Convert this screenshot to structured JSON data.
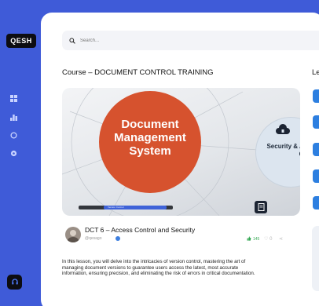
{
  "app": {
    "logo": "QESH"
  },
  "sidebar": {
    "items": [
      {
        "icon": "grid-icon"
      },
      {
        "icon": "chart-icon"
      },
      {
        "icon": "chat-icon"
      },
      {
        "icon": "settings-icon"
      }
    ],
    "help_icon": "headset-icon"
  },
  "search": {
    "placeholder": "Search..."
  },
  "course": {
    "title": "Course – DOCUMENT CONTROL TRAINING"
  },
  "side_panel": {
    "heading": "Le"
  },
  "video": {
    "main_circle_text": "Document Management System",
    "secondary_circle_text": "Security & Access Control",
    "bar_text": "Version Control"
  },
  "lesson": {
    "title": "DCT 6 – Access Control and Security",
    "author_handle": "@qesago",
    "likes": "145",
    "comments": "0",
    "description": "In this lesson, you will delve into the intricacies of version control, mastering the art of managing document versions to guarantee users access the latest, most accurate information, ensuring precision, and eliminating the risk of errors in critical documentation."
  },
  "colors": {
    "brand": "#3f5bd8",
    "accent_orange": "#d6522e",
    "check_blue": "#2d7fe0"
  }
}
